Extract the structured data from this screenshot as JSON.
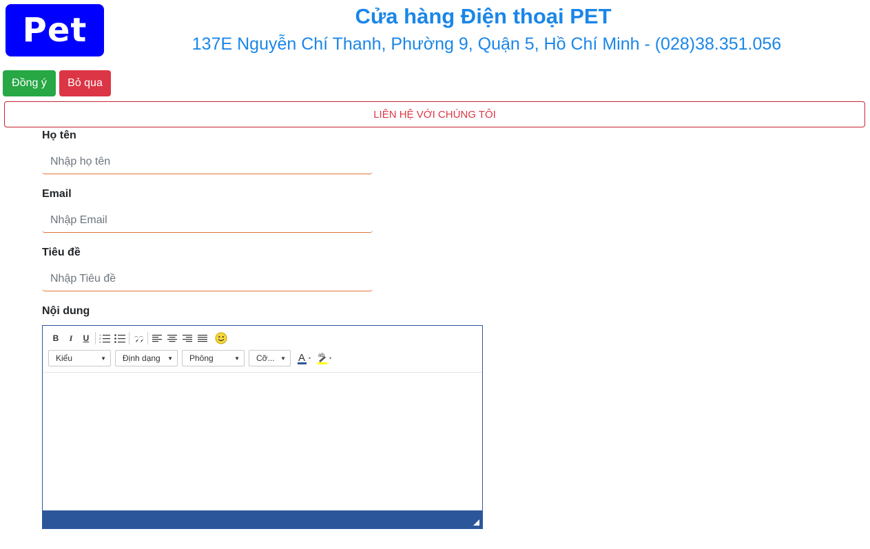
{
  "header": {
    "logo_text": "Pet",
    "title": "Cửa hàng Điện thoại PET",
    "address": "137E Nguyễn Chí Thanh, Phường 9, Quận 5, Hồ Chí Minh - (028)38.351.056"
  },
  "actions": {
    "ok_label": "Đồng ý",
    "cancel_label": "Bỏ qua"
  },
  "banner": {
    "text": "LIÊN HỆ VỚI CHÚNG TÔI"
  },
  "form": {
    "name_label": "Họ tên",
    "name_placeholder": "Nhập họ tên",
    "email_label": "Email",
    "email_placeholder": "Nhập Email",
    "subject_label": "Tiêu đề",
    "subject_placeholder": "Nhập Tiêu đề",
    "content_label": "Nội dung"
  },
  "editor": {
    "bold": "B",
    "italic": "I",
    "underline": "U",
    "styles": "Kiểu",
    "format": "Định dạng",
    "font": "Phông",
    "size": "Cỡ..."
  },
  "colors": {
    "brand_blue": "#1a86e8",
    "logo_bg": "#0000ff",
    "ok": "#28a745",
    "cancel": "#dc3545",
    "editor_bar": "#2b579a"
  }
}
